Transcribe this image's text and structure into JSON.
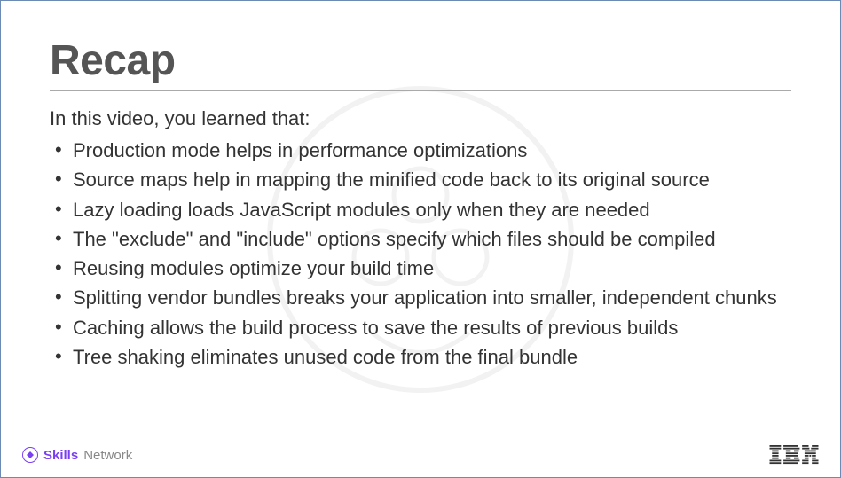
{
  "title": "Recap",
  "intro": "In this video, you learned that:",
  "bullets": [
    "Production mode helps in performance optimizations",
    "Source maps help in mapping the minified code back to its original source",
    "Lazy loading loads JavaScript modules only when they are needed",
    "The \"exclude\" and \"include\" options specify which files should be compiled",
    "Reusing modules optimize your build time",
    "Splitting vendor bundles breaks your application into smaller, independent chunks",
    "Caching allows the build process to save the results of previous builds",
    "Tree shaking eliminates unused code from the final bundle"
  ],
  "footer": {
    "brand_skills": "Skills",
    "brand_network": "Network",
    "right_logo": "IBM"
  }
}
